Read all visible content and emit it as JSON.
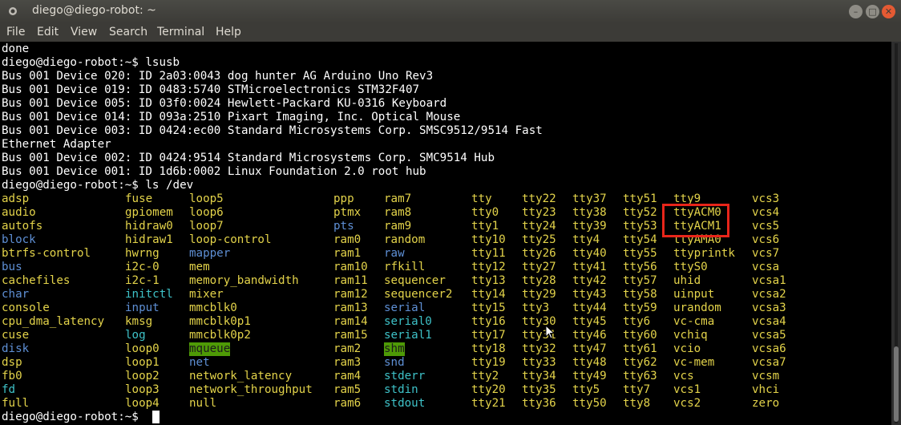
{
  "window": {
    "title": "diego@diego-robot: ~",
    "minimize_icon": "minimize-icon",
    "maximize_icon": "maximize-icon",
    "close_icon": "close-icon",
    "min_glyph": "–",
    "max_glyph": "□",
    "close_glyph": "✕"
  },
  "menu": [
    "File",
    "Edit",
    "View",
    "Search",
    "Terminal",
    "Help"
  ],
  "terminal": {
    "lines": [
      "done",
      "diego@diego-robot:~$ lsusb",
      "Bus 001 Device 020: ID 2a03:0043 dog hunter AG Arduino Uno Rev3",
      "Bus 001 Device 019: ID 0483:5740 STMicroelectronics STM32F407",
      "Bus 001 Device 005: ID 03f0:0024 Hewlett-Packard KU-0316 Keyboard",
      "Bus 001 Device 014: ID 093a:2510 Pixart Imaging, Inc. Optical Mouse",
      "Bus 001 Device 003: ID 0424:ec00 Standard Microsystems Corp. SMSC9512/9514 Fast",
      "Ethernet Adapter",
      "Bus 001 Device 002: ID 0424:9514 Standard Microsystems Corp. SMC9514 Hub",
      "Bus 001 Device 001: ID 1d6b:0002 Linux Foundation 2.0 root hub",
      "diego@diego-robot:~$ ls /dev"
    ],
    "listing_columns": [
      [
        [
          "adsp",
          "dev"
        ],
        [
          "audio",
          "dev"
        ],
        [
          "autofs",
          "dev"
        ],
        [
          "block",
          "dir"
        ],
        [
          "btrfs-control",
          "dev"
        ],
        [
          "bus",
          "dir"
        ],
        [
          "cachefiles",
          "dev"
        ],
        [
          "char",
          "dir"
        ],
        [
          "console",
          "dev"
        ],
        [
          "cpu_dma_latency",
          "dev"
        ],
        [
          "cuse",
          "dev"
        ],
        [
          "disk",
          "dir"
        ],
        [
          "dsp",
          "dev"
        ],
        [
          "fb0",
          "dev"
        ],
        [
          "fd",
          "link"
        ],
        [
          "full",
          "dev"
        ]
      ],
      [
        [
          "fuse",
          "dev"
        ],
        [
          "gpiomem",
          "dev"
        ],
        [
          "hidraw0",
          "dev"
        ],
        [
          "hidraw1",
          "dev"
        ],
        [
          "hwrng",
          "dev"
        ],
        [
          "i2c-0",
          "dev"
        ],
        [
          "i2c-1",
          "dev"
        ],
        [
          "initctl",
          "link"
        ],
        [
          "input",
          "dir"
        ],
        [
          "kmsg",
          "dev"
        ],
        [
          "log",
          "link"
        ],
        [
          "loop0",
          "dev"
        ],
        [
          "loop1",
          "dev"
        ],
        [
          "loop2",
          "dev"
        ],
        [
          "loop3",
          "dev"
        ],
        [
          "loop4",
          "dev"
        ]
      ],
      [
        [
          "loop5",
          "dev"
        ],
        [
          "loop6",
          "dev"
        ],
        [
          "loop7",
          "dev"
        ],
        [
          "loop-control",
          "dev"
        ],
        [
          "mapper",
          "dir"
        ],
        [
          "mem",
          "dev"
        ],
        [
          "memory_bandwidth",
          "dev"
        ],
        [
          "mixer",
          "dev"
        ],
        [
          "mmcblk0",
          "dev"
        ],
        [
          "mmcblk0p1",
          "dev"
        ],
        [
          "mmcblk0p2",
          "dev"
        ],
        [
          "mqueue",
          "hl"
        ],
        [
          "net",
          "dir"
        ],
        [
          "network_latency",
          "dev"
        ],
        [
          "network_throughput",
          "dev"
        ],
        [
          "null",
          "dev"
        ]
      ],
      [
        [
          "ppp",
          "dev"
        ],
        [
          "ptmx",
          "dev"
        ],
        [
          "pts",
          "dir"
        ],
        [
          "ram0",
          "dev"
        ],
        [
          "ram1",
          "dev"
        ],
        [
          "ram10",
          "dev"
        ],
        [
          "ram11",
          "dev"
        ],
        [
          "ram12",
          "dev"
        ],
        [
          "ram13",
          "dev"
        ],
        [
          "ram14",
          "dev"
        ],
        [
          "ram15",
          "dev"
        ],
        [
          "ram2",
          "dev"
        ],
        [
          "ram3",
          "dev"
        ],
        [
          "ram4",
          "dev"
        ],
        [
          "ram5",
          "dev"
        ],
        [
          "ram6",
          "dev"
        ]
      ],
      [
        [
          "ram7",
          "dev"
        ],
        [
          "ram8",
          "dev"
        ],
        [
          "ram9",
          "dev"
        ],
        [
          "random",
          "dev"
        ],
        [
          "raw",
          "dir"
        ],
        [
          "rfkill",
          "dev"
        ],
        [
          "sequencer",
          "dev"
        ],
        [
          "sequencer2",
          "dev"
        ],
        [
          "serial",
          "dir"
        ],
        [
          "serial0",
          "link"
        ],
        [
          "serial1",
          "link"
        ],
        [
          "shm",
          "hl"
        ],
        [
          "snd",
          "dir"
        ],
        [
          "stderr",
          "link"
        ],
        [
          "stdin",
          "link"
        ],
        [
          "stdout",
          "link"
        ]
      ],
      [
        [
          "tty",
          "dev"
        ],
        [
          "tty0",
          "dev"
        ],
        [
          "tty1",
          "dev"
        ],
        [
          "tty10",
          "dev"
        ],
        [
          "tty11",
          "dev"
        ],
        [
          "tty12",
          "dev"
        ],
        [
          "tty13",
          "dev"
        ],
        [
          "tty14",
          "dev"
        ],
        [
          "tty15",
          "dev"
        ],
        [
          "tty16",
          "dev"
        ],
        [
          "tty17",
          "dev"
        ],
        [
          "tty18",
          "dev"
        ],
        [
          "tty19",
          "dev"
        ],
        [
          "tty2",
          "dev"
        ],
        [
          "tty20",
          "dev"
        ],
        [
          "tty21",
          "dev"
        ]
      ],
      [
        [
          "tty22",
          "dev"
        ],
        [
          "tty23",
          "dev"
        ],
        [
          "tty24",
          "dev"
        ],
        [
          "tty25",
          "dev"
        ],
        [
          "tty26",
          "dev"
        ],
        [
          "tty27",
          "dev"
        ],
        [
          "tty28",
          "dev"
        ],
        [
          "tty29",
          "dev"
        ],
        [
          "tty3",
          "dev"
        ],
        [
          "tty30",
          "dev"
        ],
        [
          "tty31",
          "dev"
        ],
        [
          "tty32",
          "dev"
        ],
        [
          "tty33",
          "dev"
        ],
        [
          "tty34",
          "dev"
        ],
        [
          "tty35",
          "dev"
        ],
        [
          "tty36",
          "dev"
        ]
      ],
      [
        [
          "tty37",
          "dev"
        ],
        [
          "tty38",
          "dev"
        ],
        [
          "tty39",
          "dev"
        ],
        [
          "tty4",
          "dev"
        ],
        [
          "tty40",
          "dev"
        ],
        [
          "tty41",
          "dev"
        ],
        [
          "tty42",
          "dev"
        ],
        [
          "tty43",
          "dev"
        ],
        [
          "tty44",
          "dev"
        ],
        [
          "tty45",
          "dev"
        ],
        [
          "tty46",
          "dev"
        ],
        [
          "tty47",
          "dev"
        ],
        [
          "tty48",
          "dev"
        ],
        [
          "tty49",
          "dev"
        ],
        [
          "tty5",
          "dev"
        ],
        [
          "tty50",
          "dev"
        ]
      ],
      [
        [
          "tty51",
          "dev"
        ],
        [
          "tty52",
          "dev"
        ],
        [
          "tty53",
          "dev"
        ],
        [
          "tty54",
          "dev"
        ],
        [
          "tty55",
          "dev"
        ],
        [
          "tty56",
          "dev"
        ],
        [
          "tty57",
          "dev"
        ],
        [
          "tty58",
          "dev"
        ],
        [
          "tty59",
          "dev"
        ],
        [
          "tty6",
          "dev"
        ],
        [
          "tty60",
          "dev"
        ],
        [
          "tty61",
          "dev"
        ],
        [
          "tty62",
          "dev"
        ],
        [
          "tty63",
          "dev"
        ],
        [
          "tty7",
          "dev"
        ],
        [
          "tty8",
          "dev"
        ]
      ],
      [
        [
          "tty9",
          "dev"
        ],
        [
          "ttyACM0",
          "dev"
        ],
        [
          "ttyACM1",
          "dev"
        ],
        [
          "ttyAMA0",
          "dev"
        ],
        [
          "ttyprintk",
          "dev"
        ],
        [
          "ttyS0",
          "dev"
        ],
        [
          "uhid",
          "dev"
        ],
        [
          "uinput",
          "dev"
        ],
        [
          "urandom",
          "dev"
        ],
        [
          "vc-cma",
          "dev"
        ],
        [
          "vchiq",
          "dev"
        ],
        [
          "vcio",
          "dev"
        ],
        [
          "vc-mem",
          "dev"
        ],
        [
          "vcs",
          "dev"
        ],
        [
          "vcs1",
          "dev"
        ],
        [
          "vcs2",
          "dev"
        ]
      ],
      [
        [
          "vcs3",
          "dev"
        ],
        [
          "vcs4",
          "dev"
        ],
        [
          "vcs5",
          "dev"
        ],
        [
          "vcs6",
          "dev"
        ],
        [
          "vcs7",
          "dev"
        ],
        [
          "vcsa",
          "dev"
        ],
        [
          "vcsa1",
          "dev"
        ],
        [
          "vcsa2",
          "dev"
        ],
        [
          "vcsa3",
          "dev"
        ],
        [
          "vcsa4",
          "dev"
        ],
        [
          "vcsa5",
          "dev"
        ],
        [
          "vcsa6",
          "dev"
        ],
        [
          "vcsa7",
          "dev"
        ],
        [
          "vcsm",
          "dev"
        ],
        [
          "vhci",
          "dev"
        ],
        [
          "zero",
          "dev"
        ]
      ]
    ],
    "prompt": "diego@diego-robot:~$ "
  },
  "colors": {
    "background": "#000000",
    "text": "#ffffff",
    "device": "#e3d34a",
    "directory": "#5e8fd4",
    "symlink": "#3ec2c8",
    "sticky_dir_bg": "#4e9a06",
    "annotation": "#e8251a"
  }
}
